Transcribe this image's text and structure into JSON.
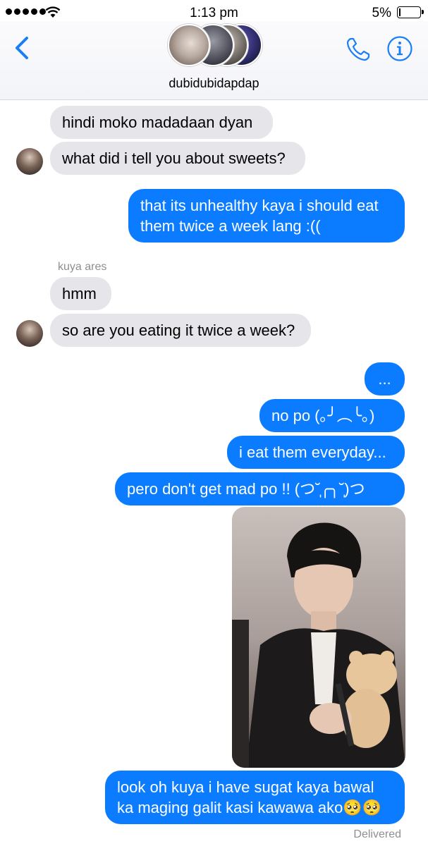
{
  "status_bar": {
    "time": "1:13 pm",
    "battery": "5%"
  },
  "header": {
    "contact_name": "dubidubidapdap",
    "avatar_count": 4
  },
  "conversation": {
    "messages": [
      {
        "direction": "incoming",
        "text": "hindi moko madadaan dyan"
      },
      {
        "direction": "incoming",
        "text": "what did i tell you about sweets?"
      },
      {
        "direction": "outgoing",
        "text": "that its unhealthy kaya i should eat them twice a week lang :(("
      },
      {
        "direction": "incoming",
        "sender": "kuya ares",
        "text": "hmm"
      },
      {
        "direction": "incoming",
        "text": "so are you eating it twice a week?"
      },
      {
        "direction": "outgoing",
        "text": "..."
      },
      {
        "direction": "outgoing",
        "text": "no po (｡╯︵╰｡)"
      },
      {
        "direction": "outgoing",
        "text": "i eat them everyday..."
      },
      {
        "direction": "outgoing",
        "text": "pero don't get mad po !! (つ˘̩╭╮˘̩)つ"
      },
      {
        "direction": "outgoing",
        "type": "photo"
      },
      {
        "direction": "outgoing",
        "text": "look oh kuya i have sugat kaya bawal ka maging galit kasi kawawa ako🥺🥺"
      }
    ],
    "delivery_status": "Delivered"
  },
  "colors": {
    "outgoing_bubble": "#0b7cff",
    "incoming_bubble": "#e5e5ea",
    "accent": "#1a7ef5"
  }
}
